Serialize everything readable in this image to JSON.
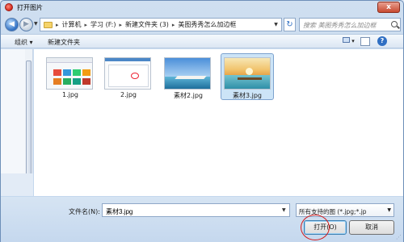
{
  "window": {
    "title": "打开图片",
    "close_glyph": "x"
  },
  "nav": {
    "back_glyph": "◀",
    "forward_glyph": "▶"
  },
  "address": {
    "segments": [
      "计算机",
      "学习 (F:)",
      "新建文件夹 (3)",
      "美图秀秀怎么加边框"
    ],
    "separator": "▸",
    "refresh_glyph": "↻"
  },
  "search": {
    "placeholder": "搜索 美图秀秀怎么加边框"
  },
  "toolbar": {
    "organize_label": "组织 ▾",
    "new_folder_label": "新建文件夹",
    "help_glyph": "?"
  },
  "files": [
    {
      "name": "1.jpg",
      "selected": false,
      "thumb": "web-page-tiles"
    },
    {
      "name": "2.jpg",
      "selected": false,
      "thumb": "dialog-screenshot"
    },
    {
      "name": "素材2.jpg",
      "selected": false,
      "thumb": "sea-pier-photo"
    },
    {
      "name": "素材3.jpg",
      "selected": true,
      "thumb": "sunset-pier-photo"
    }
  ],
  "bottom": {
    "filename_label": "文件名(N):",
    "filename_value": "素材3.jpg",
    "filetype_value": "所有支持的图   (*.jpg;*.jp",
    "open_label": "打开(O)",
    "cancel_label": "取消"
  },
  "colors": {
    "accent": "#2f6fc3",
    "selection": "#cce4f7",
    "highlight_circle": "#d41a1a"
  }
}
